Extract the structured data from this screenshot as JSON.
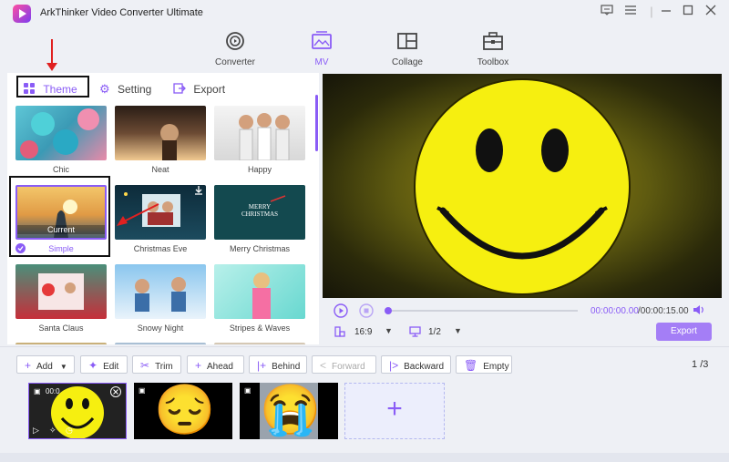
{
  "app": {
    "title": "ArkThinker Video Converter Ultimate"
  },
  "window_controls": {
    "feedback": "feedback-icon",
    "menu": "menu-icon",
    "minimize": "minimize-icon",
    "maximize": "maximize-icon",
    "close": "close-icon"
  },
  "nav": [
    {
      "label": "Converter",
      "icon": "converter-icon"
    },
    {
      "label": "MV",
      "icon": "mv-icon",
      "active": true
    },
    {
      "label": "Collage",
      "icon": "collage-icon"
    },
    {
      "label": "Toolbox",
      "icon": "toolbox-icon"
    }
  ],
  "panel_tabs": {
    "theme": "Theme",
    "setting": "Setting",
    "export": "Export"
  },
  "themes": {
    "chic": "Chic",
    "neat": "Neat",
    "happy": "Happy",
    "simple": "Simple",
    "simple_badge": "Current",
    "christmas_eve": "Christmas Eve",
    "merry_christmas": "Merry Christmas",
    "merry_christmas_card_text": "MERRY CHRISTMAS",
    "santa_claus": "Santa Claus",
    "snowy_night": "Snowy Night",
    "stripes_waves": "Stripes & Waves"
  },
  "playback": {
    "current_time": "00:00:00.00",
    "total_time": "/00:00:15.00",
    "progress": 0.0,
    "aspect_ratio": "16:9",
    "page": "1/2",
    "export_label": "Export"
  },
  "toolbar": {
    "add": "Add",
    "edit": "Edit",
    "trim": "Trim",
    "ahead": "Ahead",
    "behind": "Behind",
    "forward": "Forward",
    "backward": "Backward",
    "empty": "Empty",
    "page_current": "1",
    "page_total": "/3"
  },
  "timeline": {
    "clips": [
      {
        "emoji": "smiley",
        "time": "00:0"
      },
      {
        "emoji": "😔"
      },
      {
        "emoji": "😭"
      }
    ],
    "add_tile": "+"
  },
  "colors": {
    "accent": "#8a5cf6",
    "preview_face": "#f6ef10",
    "annotation": "#e02020"
  }
}
